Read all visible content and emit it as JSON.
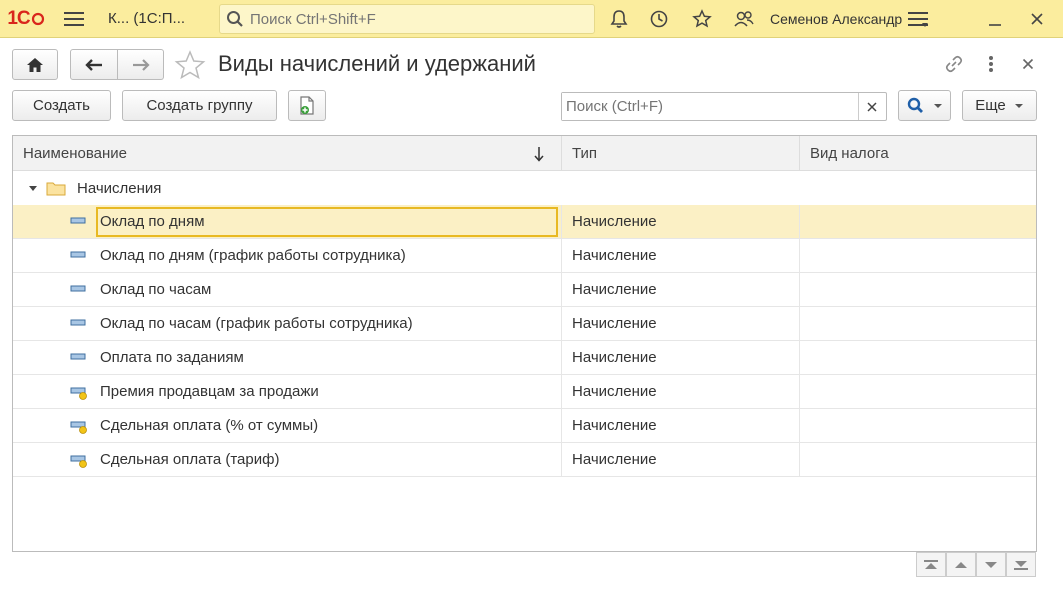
{
  "topbar": {
    "logo": "1С",
    "app_title": "К...  (1С:П...",
    "search_placeholder": "Поиск Ctrl+Shift+F",
    "user_name": "Семенов Александр",
    "icons": [
      "menu-icon",
      "search-icon",
      "bell-icon",
      "history-icon",
      "star-icon",
      "users-icon",
      "settings-icon",
      "minimize-icon",
      "close-icon"
    ]
  },
  "header": {
    "title": "Виды начислений и удержаний",
    "icons": [
      "home-icon",
      "back-arrow-icon",
      "forward-arrow-icon",
      "favorite-star-icon",
      "link-icon",
      "more-vertical-icon",
      "close-icon"
    ]
  },
  "commandbar": {
    "create_label": "Создать",
    "create_group_label": "Создать группу",
    "search_placeholder": "Поиск (Ctrl+F)",
    "more_label": "Еще"
  },
  "table": {
    "columns": [
      "Наименование",
      "Тип",
      "Вид налога"
    ],
    "group": "Начисления",
    "rows": [
      {
        "name": "Оклад по дням",
        "type": "Начисление",
        "tax": "",
        "icon": "item-icon",
        "selected": true
      },
      {
        "name": "Оклад по дням (график работы сотрудника)",
        "type": "Начисление",
        "tax": "",
        "icon": "item-icon"
      },
      {
        "name": "Оклад по часам",
        "type": "Начисление",
        "tax": "",
        "icon": "item-icon"
      },
      {
        "name": "Оклад по часам (график работы сотрудника)",
        "type": "Начисление",
        "tax": "",
        "icon": "item-icon"
      },
      {
        "name": "Оплата по заданиям",
        "type": "Начисление",
        "tax": "",
        "icon": "item-icon"
      },
      {
        "name": "Премия продавцам за продажи",
        "type": "Начисление",
        "tax": "",
        "icon": "item-extended-icon"
      },
      {
        "name": "Сдельная оплата (% от суммы)",
        "type": "Начисление",
        "tax": "",
        "icon": "item-extended-icon"
      },
      {
        "name": "Сдельная оплата (тариф)",
        "type": "Начисление",
        "tax": "",
        "icon": "item-extended-icon"
      }
    ]
  },
  "colors": {
    "topbar_bg": "#fbed9e",
    "selected_row": "#fbf0c5",
    "selected_border": "#e8b923",
    "logo_red": "#d9261c"
  }
}
